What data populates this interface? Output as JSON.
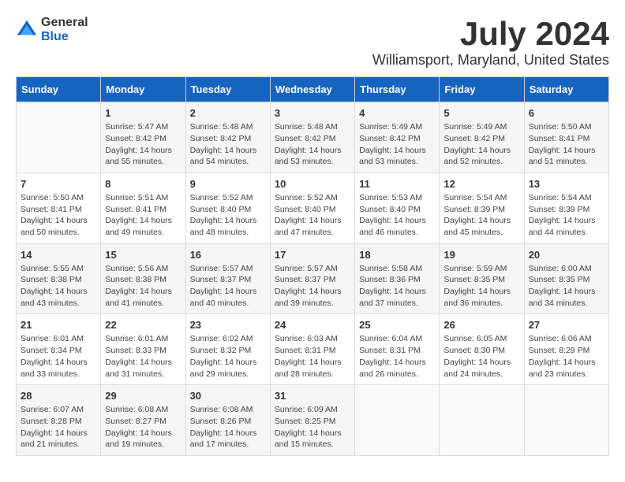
{
  "logo": {
    "general": "General",
    "blue": "Blue"
  },
  "title": "July 2024",
  "subtitle": "Williamsport, Maryland, United States",
  "header": {
    "days": [
      "Sunday",
      "Monday",
      "Tuesday",
      "Wednesday",
      "Thursday",
      "Friday",
      "Saturday"
    ]
  },
  "weeks": [
    {
      "cells": [
        {
          "day": "",
          "info": ""
        },
        {
          "day": "1",
          "info": "Sunrise: 5:47 AM\nSunset: 8:42 PM\nDaylight: 14 hours\nand 55 minutes."
        },
        {
          "day": "2",
          "info": "Sunrise: 5:48 AM\nSunset: 8:42 PM\nDaylight: 14 hours\nand 54 minutes."
        },
        {
          "day": "3",
          "info": "Sunrise: 5:48 AM\nSunset: 8:42 PM\nDaylight: 14 hours\nand 53 minutes."
        },
        {
          "day": "4",
          "info": "Sunrise: 5:49 AM\nSunset: 8:42 PM\nDaylight: 14 hours\nand 53 minutes."
        },
        {
          "day": "5",
          "info": "Sunrise: 5:49 AM\nSunset: 8:42 PM\nDaylight: 14 hours\nand 52 minutes."
        },
        {
          "day": "6",
          "info": "Sunrise: 5:50 AM\nSunset: 8:41 PM\nDaylight: 14 hours\nand 51 minutes."
        }
      ]
    },
    {
      "cells": [
        {
          "day": "7",
          "info": "Sunrise: 5:50 AM\nSunset: 8:41 PM\nDaylight: 14 hours\nand 50 minutes."
        },
        {
          "day": "8",
          "info": "Sunrise: 5:51 AM\nSunset: 8:41 PM\nDaylight: 14 hours\nand 49 minutes."
        },
        {
          "day": "9",
          "info": "Sunrise: 5:52 AM\nSunset: 8:40 PM\nDaylight: 14 hours\nand 48 minutes."
        },
        {
          "day": "10",
          "info": "Sunrise: 5:52 AM\nSunset: 8:40 PM\nDaylight: 14 hours\nand 47 minutes."
        },
        {
          "day": "11",
          "info": "Sunrise: 5:53 AM\nSunset: 8:40 PM\nDaylight: 14 hours\nand 46 minutes."
        },
        {
          "day": "12",
          "info": "Sunrise: 5:54 AM\nSunset: 8:39 PM\nDaylight: 14 hours\nand 45 minutes."
        },
        {
          "day": "13",
          "info": "Sunrise: 5:54 AM\nSunset: 8:39 PM\nDaylight: 14 hours\nand 44 minutes."
        }
      ]
    },
    {
      "cells": [
        {
          "day": "14",
          "info": "Sunrise: 5:55 AM\nSunset: 8:38 PM\nDaylight: 14 hours\nand 43 minutes."
        },
        {
          "day": "15",
          "info": "Sunrise: 5:56 AM\nSunset: 8:38 PM\nDaylight: 14 hours\nand 41 minutes."
        },
        {
          "day": "16",
          "info": "Sunrise: 5:57 AM\nSunset: 8:37 PM\nDaylight: 14 hours\nand 40 minutes."
        },
        {
          "day": "17",
          "info": "Sunrise: 5:57 AM\nSunset: 8:37 PM\nDaylight: 14 hours\nand 39 minutes."
        },
        {
          "day": "18",
          "info": "Sunrise: 5:58 AM\nSunset: 8:36 PM\nDaylight: 14 hours\nand 37 minutes."
        },
        {
          "day": "19",
          "info": "Sunrise: 5:59 AM\nSunset: 8:35 PM\nDaylight: 14 hours\nand 36 minutes."
        },
        {
          "day": "20",
          "info": "Sunrise: 6:00 AM\nSunset: 8:35 PM\nDaylight: 14 hours\nand 34 minutes."
        }
      ]
    },
    {
      "cells": [
        {
          "day": "21",
          "info": "Sunrise: 6:01 AM\nSunset: 8:34 PM\nDaylight: 14 hours\nand 33 minutes."
        },
        {
          "day": "22",
          "info": "Sunrise: 6:01 AM\nSunset: 8:33 PM\nDaylight: 14 hours\nand 31 minutes."
        },
        {
          "day": "23",
          "info": "Sunrise: 6:02 AM\nSunset: 8:32 PM\nDaylight: 14 hours\nand 29 minutes."
        },
        {
          "day": "24",
          "info": "Sunrise: 6:03 AM\nSunset: 8:31 PM\nDaylight: 14 hours\nand 28 minutes."
        },
        {
          "day": "25",
          "info": "Sunrise: 6:04 AM\nSunset: 8:31 PM\nDaylight: 14 hours\nand 26 minutes."
        },
        {
          "day": "26",
          "info": "Sunrise: 6:05 AM\nSunset: 8:30 PM\nDaylight: 14 hours\nand 24 minutes."
        },
        {
          "day": "27",
          "info": "Sunrise: 6:06 AM\nSunset: 8:29 PM\nDaylight: 14 hours\nand 23 minutes."
        }
      ]
    },
    {
      "cells": [
        {
          "day": "28",
          "info": "Sunrise: 6:07 AM\nSunset: 8:28 PM\nDaylight: 14 hours\nand 21 minutes."
        },
        {
          "day": "29",
          "info": "Sunrise: 6:08 AM\nSunset: 8:27 PM\nDaylight: 14 hours\nand 19 minutes."
        },
        {
          "day": "30",
          "info": "Sunrise: 6:08 AM\nSunset: 8:26 PM\nDaylight: 14 hours\nand 17 minutes."
        },
        {
          "day": "31",
          "info": "Sunrise: 6:09 AM\nSunset: 8:25 PM\nDaylight: 14 hours\nand 15 minutes."
        },
        {
          "day": "",
          "info": ""
        },
        {
          "day": "",
          "info": ""
        },
        {
          "day": "",
          "info": ""
        }
      ]
    }
  ]
}
